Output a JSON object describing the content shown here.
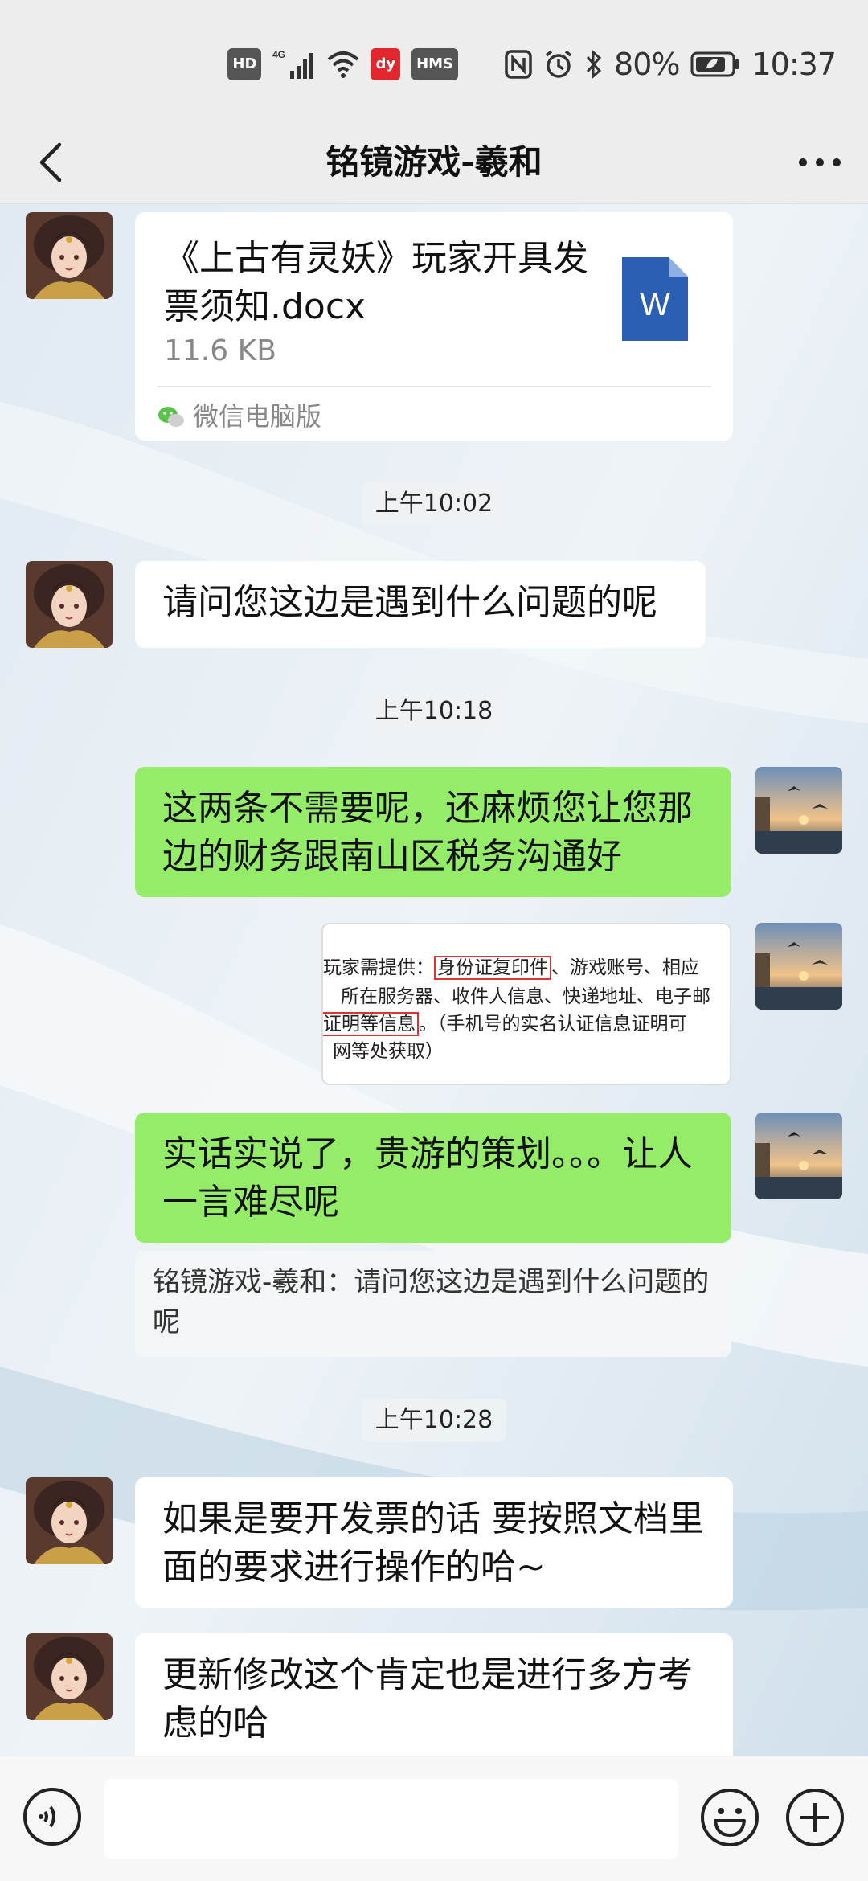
{
  "status_bar": {
    "hd": "HD",
    "network": "4G",
    "app_badge": "dy",
    "hms": "HMS",
    "battery": "80%",
    "time": "10:37"
  },
  "header": {
    "title": "铭镜游戏-羲和"
  },
  "messages": {
    "file": {
      "name": "《上古有灵妖》玩家开具发票须知.docx",
      "size": "11.6 KB",
      "source": "微信电脑版",
      "icon_letter": "W"
    },
    "ts1": "上午10:02",
    "msg1": "请问您这边是遇到什么问题的呢",
    "ts2": "上午10:18",
    "msg2": "这两条不需要呢，还麻烦您让您那边的财务跟南山区税务沟通好",
    "image": {
      "line1_prefix": "玩家需提供：",
      "line1_boxed": "身份证复印件",
      "line1_suffix": "、游戏账号、相应",
      "line2": "所在服务器、收件人信息、快递地址、电子邮",
      "line3_boxed": "证明等信息",
      "line3_suffix": "。（手机号的实名认证信息证明可",
      "line4": "网等处获取）"
    },
    "msg3": "实话实说了，贵游的策划。。。让人一言难尽呢",
    "quote": "铭镜游戏-羲和：请问您这边是遇到什么问题的呢",
    "ts3": "上午10:28",
    "msg4": "如果是要开发票的话 要按照文档里面的要求进行操作的哈~",
    "msg5": "更新修改这个肯定也是进行多方考虑的哈"
  },
  "colors": {
    "green_bubble": "#95ec69",
    "white_bubble": "#ffffff",
    "bar_bg": "#ededed"
  }
}
